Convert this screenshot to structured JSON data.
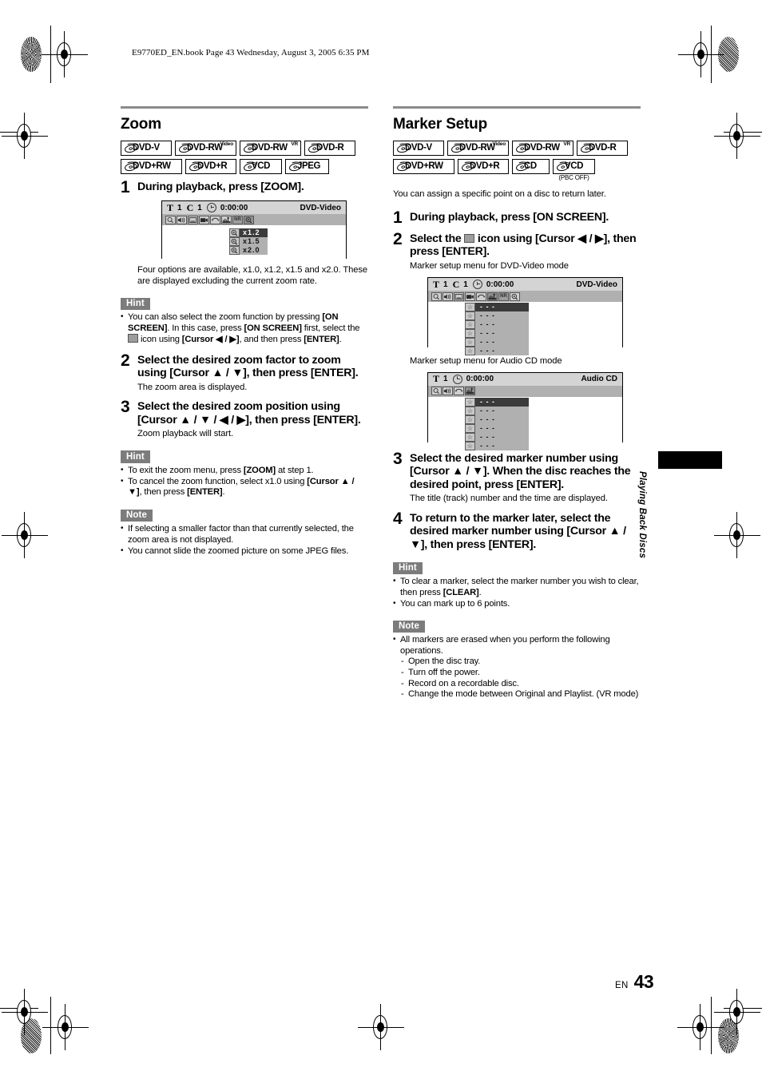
{
  "header": {
    "book_line": "E9770ED_EN.book  Page 43  Wednesday, August 3, 2005  6:35 PM"
  },
  "footer": {
    "lang": "EN",
    "page_number": "43"
  },
  "side_tab": {
    "label": "Playing Back Discs"
  },
  "left_column": {
    "title": "Zoom",
    "disc_badges_row1": [
      {
        "label": "DVD-V",
        "sup": ""
      },
      {
        "label": "DVD-RW",
        "sup": "Video"
      },
      {
        "label": "DVD-RW",
        "sup": "VR"
      },
      {
        "label": "DVD-R",
        "sup": ""
      }
    ],
    "disc_badges_row2": [
      {
        "label": "DVD+RW",
        "sup": ""
      },
      {
        "label": "DVD+R",
        "sup": ""
      },
      {
        "label": "VCD",
        "sup": ""
      },
      {
        "label": "JPEG",
        "sup": ""
      }
    ],
    "step1": {
      "num": "1",
      "text": "During playback, press [ZOOM]."
    },
    "osd": {
      "title_label": "T",
      "title_value": "1",
      "chapter_label": "C",
      "chapter_value": "1",
      "time": "0:00:00",
      "disc_type": "DVD-Video",
      "icons": [
        "angle-icon",
        "audio-icon",
        "subtitle-icon",
        "marker-icon",
        "repeat-icon",
        "marker-setup-icon",
        "NR",
        "zoom-icon"
      ],
      "menu": [
        {
          "value": "x1.2",
          "highlight": true
        },
        {
          "value": "x1.5",
          "highlight": false
        },
        {
          "value": "x2.0",
          "highlight": false
        }
      ]
    },
    "osd_caption": "Four options are available, x1.0, x1.2, x1.5 and x2.0. These are displayed excluding the current zoom rate.",
    "hint1": {
      "tag": "Hint",
      "bullets_html": [
        "You can also select the zoom function by pressing <b>[ON SCREEN]</b>. In this case, press <b>[ON SCREEN]</b> first, select the <span class=\"inlineico\" data-name=\"zoom-icon\"></span> icon using <b>[Cursor ◀ / ▶]</b>, and then press <b>[ENTER]</b>."
      ]
    },
    "step2": {
      "num": "2",
      "text": "Select the desired zoom factor to zoom using [Cursor ▲ / ▼], then press [ENTER].",
      "sub": "The zoom area is displayed."
    },
    "step3": {
      "num": "3",
      "text": "Select the desired zoom position using [Cursor ▲ / ▼ / ◀ / ▶], then press [ENTER].",
      "sub": "Zoom playback will start."
    },
    "hint2": {
      "tag": "Hint",
      "bullets_html": [
        "To exit the zoom menu, press <b>[ZOOM]</b> at step 1.",
        "To cancel the zoom function, select x1.0 using <b>[Cursor ▲ / ▼]</b>, then press <b>[ENTER]</b>."
      ]
    },
    "note1": {
      "tag": "Note",
      "bullets_html": [
        "If selecting a smaller factor than that currently selected, the zoom area is not displayed.",
        "You cannot slide the zoomed picture on some JPEG files."
      ]
    }
  },
  "right_column": {
    "title": "Marker Setup",
    "disc_badges_row1": [
      {
        "label": "DVD-V",
        "sup": ""
      },
      {
        "label": "DVD-RW",
        "sup": "Video"
      },
      {
        "label": "DVD-RW",
        "sup": "VR"
      },
      {
        "label": "DVD-R",
        "sup": ""
      }
    ],
    "disc_badges_row2": [
      {
        "label": "DVD+RW",
        "sup": "",
        "sub": ""
      },
      {
        "label": "DVD+R",
        "sup": "",
        "sub": ""
      },
      {
        "label": "CD",
        "sup": "",
        "sub": ""
      },
      {
        "label": "VCD",
        "sup": "",
        "sub": "(PBC OFF)"
      }
    ],
    "intro": "You can assign a specific point on a disc to return later.",
    "step1": {
      "num": "1",
      "text": "During playback, press [ON SCREEN]."
    },
    "step2": {
      "num": "2",
      "text_before": "Select the ",
      "text_after": " icon using [Cursor ◀ / ▶], then press [ENTER].",
      "caption": "Marker setup menu for DVD-Video mode"
    },
    "osd_dvd": {
      "title_label": "T",
      "title_value": "1",
      "chapter_label": "C",
      "chapter_value": "1",
      "time": "0:00:00",
      "disc_type": "DVD-Video",
      "icons": [
        "angle-icon",
        "audio-icon",
        "subtitle-icon",
        "marker-icon",
        "repeat-icon",
        "marker-setup-icon",
        "NR",
        "zoom-icon"
      ],
      "markers": [
        {
          "value": "- - -",
          "highlight": true
        },
        {
          "value": "- - -",
          "highlight": false
        },
        {
          "value": "- - -",
          "highlight": false
        },
        {
          "value": "- - -",
          "highlight": false
        },
        {
          "value": "- - -",
          "highlight": false
        },
        {
          "value": "- - -",
          "highlight": false
        }
      ]
    },
    "osd_cd_caption": "Marker setup menu for Audio CD mode",
    "osd_cd": {
      "title_label": "T",
      "title_value": "1",
      "time": "0:00:00",
      "disc_type": "Audio CD",
      "icons": [
        "angle-icon",
        "audio-icon",
        "repeat-icon",
        "marker-setup-icon"
      ],
      "markers": [
        {
          "value": "- - -",
          "highlight": true
        },
        {
          "value": "- - -",
          "highlight": false
        },
        {
          "value": "- - -",
          "highlight": false
        },
        {
          "value": "- - -",
          "highlight": false
        },
        {
          "value": "- - -",
          "highlight": false
        },
        {
          "value": "- - -",
          "highlight": false
        }
      ]
    },
    "step3": {
      "num": "3",
      "text": "Select the desired marker number using [Cursor ▲ / ▼]. When the disc reaches the desired point, press [ENTER].",
      "sub": "The title (track) number and the time are displayed."
    },
    "step4": {
      "num": "4",
      "text": "To return to the marker later, select the desired marker number using [Cursor ▲ / ▼], then press [ENTER]."
    },
    "hint1": {
      "tag": "Hint",
      "bullets_html": [
        "To clear a marker, select the marker number you wish to clear, then press <b>[CLEAR]</b>.",
        "You can mark up to 6 points."
      ]
    },
    "note1": {
      "tag": "Note",
      "bullets_intro_html": "All markers are erased when you perform the following operations.",
      "dashes": [
        "Open the disc tray.",
        "Turn off the power.",
        "Record on a recordable disc.",
        "Change the mode between Original and Playlist. (VR mode)"
      ]
    }
  },
  "colors": {
    "rule": "#8b8b8b",
    "tag_bg": "#7c7c7c",
    "osd_bar1": "#d4d4d4",
    "osd_bar2": "#b0b0b0",
    "osd_highlight": "#3b3b3b"
  }
}
